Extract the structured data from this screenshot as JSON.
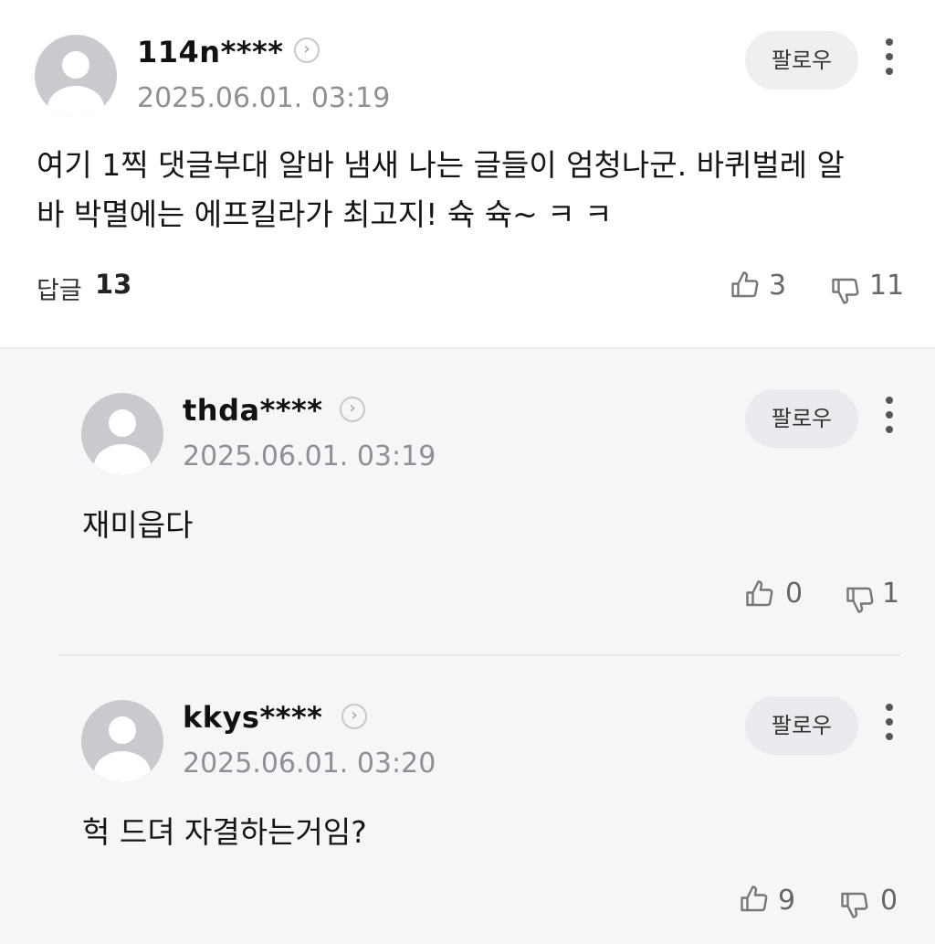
{
  "comment": {
    "username": "114n****",
    "date": "2025.06.01. 03:19",
    "follow_label": "팔로우",
    "text": "여기 1찍 댓글부대 알바 냄새 나는 글들이 엄청나군. 바퀴벌레 알바 박멸에는 에프킬라가 최고지! 슉 슉~ ㅋ ㅋ",
    "reply_label": "답글",
    "reply_count": "13",
    "likes": "3",
    "dislikes": "11"
  },
  "replies": [
    {
      "username": "thda****",
      "date": "2025.06.01. 03:19",
      "follow_label": "팔로우",
      "text": "재미읍다",
      "likes": "0",
      "dislikes": "1"
    },
    {
      "username": "kkys****",
      "date": "2025.06.01. 03:20",
      "follow_label": "팔로우",
      "text": "헉 드뎌 자결하는거임?",
      "likes": "9",
      "dislikes": "0"
    }
  ],
  "icons": {
    "avatar": "avatar-default-icon",
    "profile_link": "chevron-right-icon",
    "more": "more-vertical-icon",
    "like": "thumbs-up-icon",
    "dislike": "thumbs-down-icon"
  },
  "colors": {
    "reply_background": "#f6f6f8",
    "follow_button": "#efeff1",
    "muted_text": "#8f8f95"
  }
}
